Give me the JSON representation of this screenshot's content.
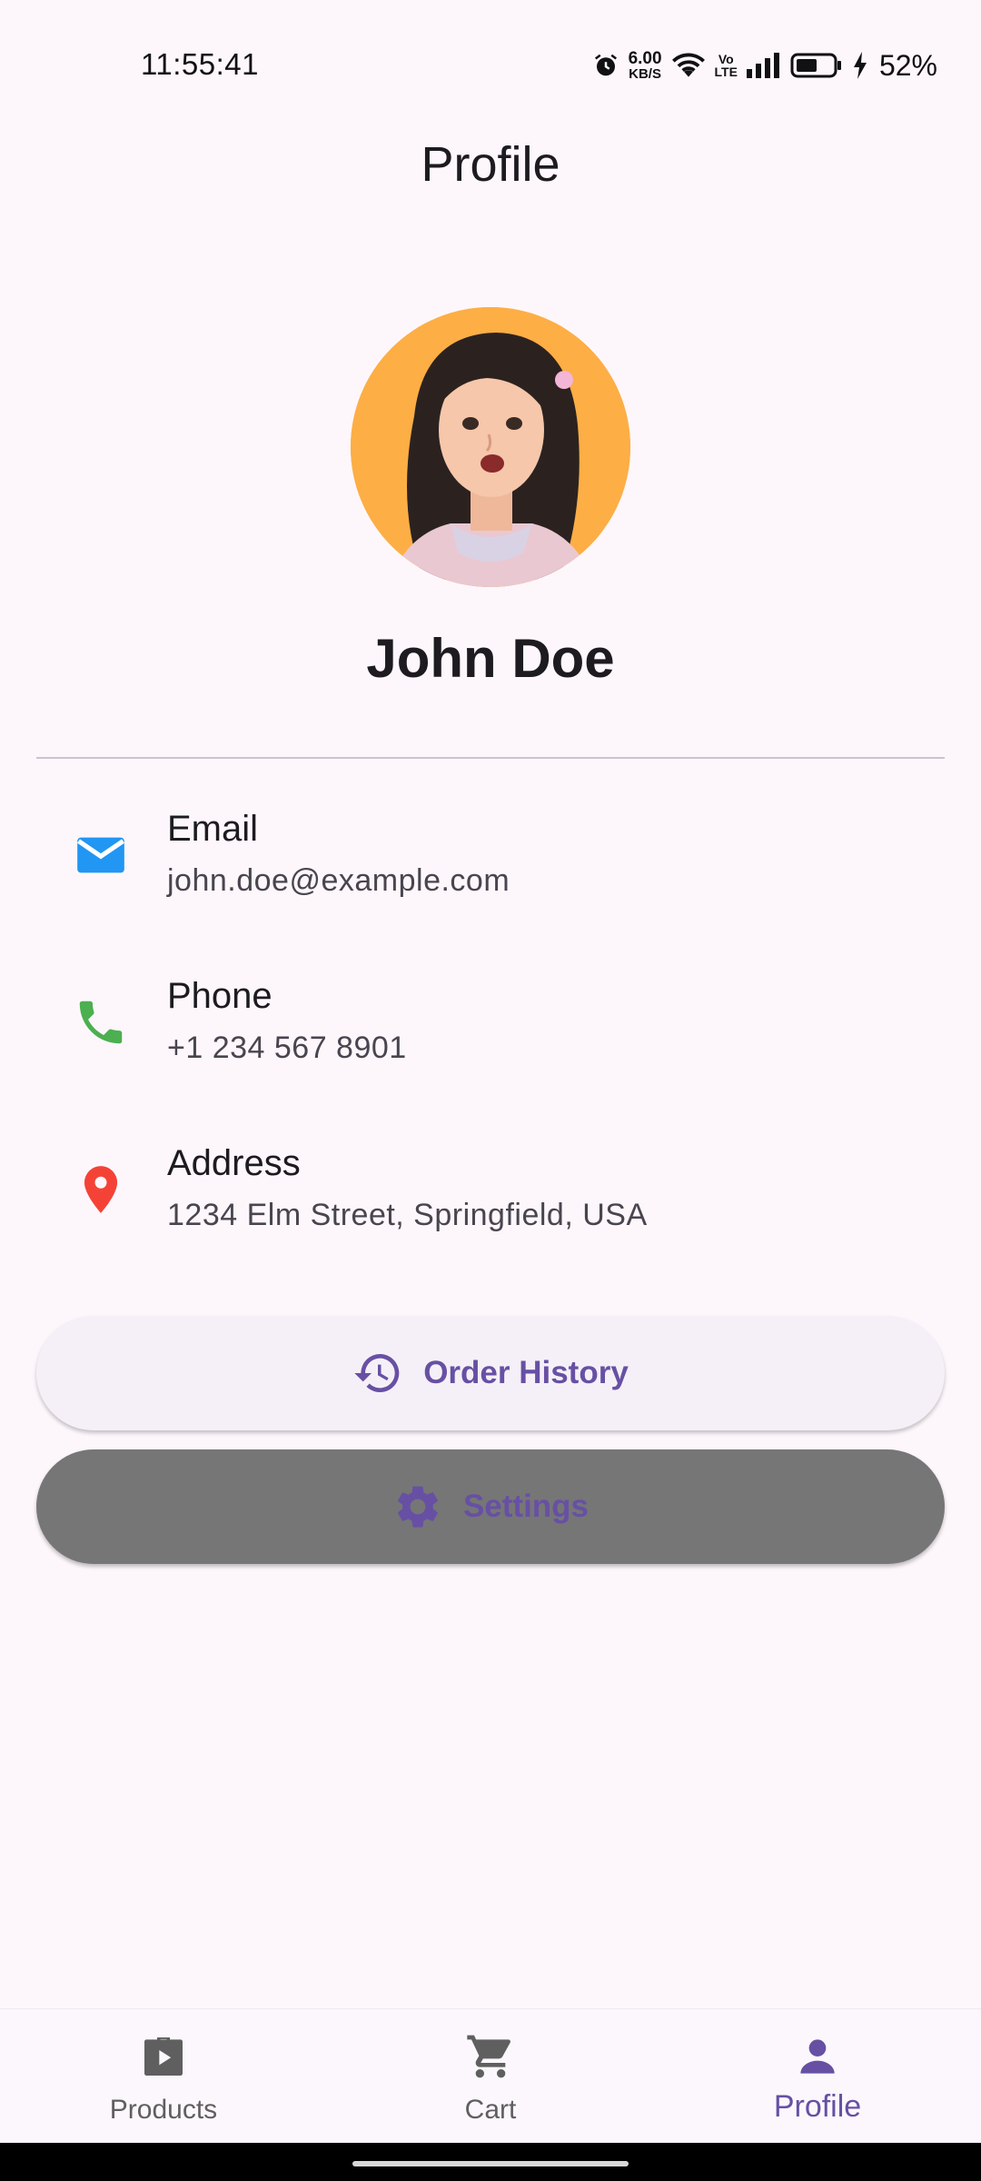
{
  "status_bar": {
    "time": "11:55:41",
    "net_speed_value": "6.00",
    "net_speed_unit": "KB/S",
    "volte_top": "Vo",
    "volte_bottom": "LTE",
    "battery_percent": "52%",
    "icons": [
      "alarm-icon",
      "wifi-icon",
      "signal-icon",
      "battery-icon",
      "charging-icon"
    ]
  },
  "app_bar": {
    "title": "Profile"
  },
  "profile": {
    "name": "John Doe"
  },
  "info": [
    {
      "label": "Email",
      "value": "john.doe@example.com",
      "icon": "email-icon",
      "color": "#2196f3"
    },
    {
      "label": "Phone",
      "value": "+1 234 567 8901",
      "icon": "phone-icon",
      "color": "#4caf50"
    },
    {
      "label": "Address",
      "value": "1234 Elm Street, Springfield, USA",
      "icon": "location-pin-icon",
      "color": "#f44336"
    }
  ],
  "buttons": {
    "order_history": "Order History",
    "settings": "Settings"
  },
  "nav": {
    "items": [
      {
        "label": "Products",
        "icon": "products-icon",
        "active": false
      },
      {
        "label": "Cart",
        "icon": "cart-icon",
        "active": false
      },
      {
        "label": "Profile",
        "icon": "person-icon",
        "active": true
      }
    ]
  },
  "colors": {
    "background": "#fdf7fc",
    "primary": "#6750a4",
    "settings_button_bg": "#767676"
  }
}
